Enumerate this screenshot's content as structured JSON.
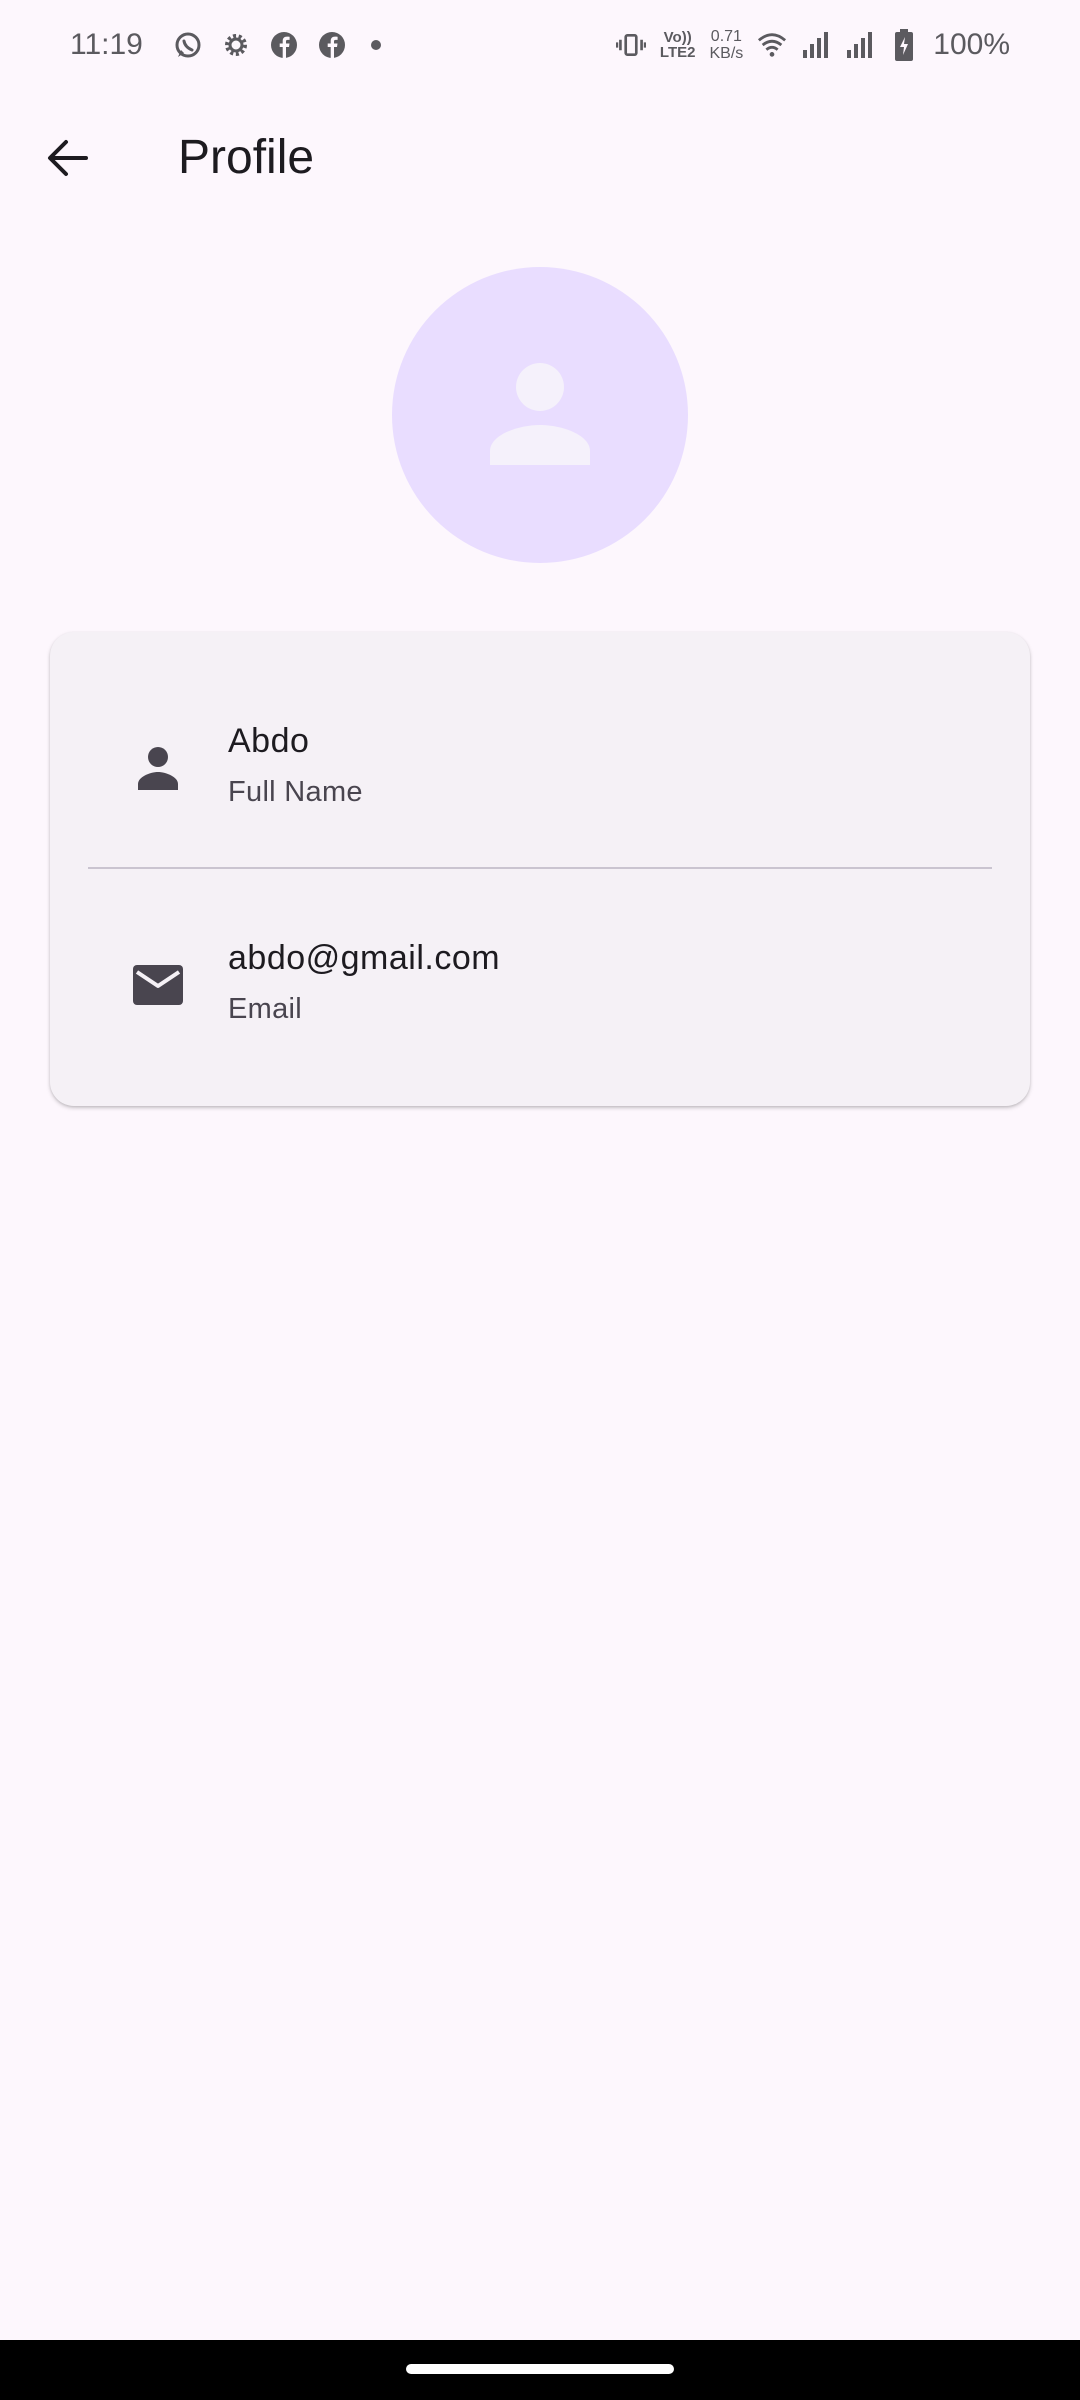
{
  "status_bar": {
    "time": "11:19",
    "network_speed_value": "0.71",
    "network_speed_unit": "KB/s",
    "volte_top": "Vo))",
    "volte_bottom": "LTE2",
    "battery": "100%",
    "icons": [
      "whatsapp-icon",
      "settings-gear-icon",
      "facebook-icon",
      "facebook-icon",
      "notification-dot",
      "vibrate-icon",
      "volte-icon",
      "wifi-icon",
      "signal-icon",
      "signal-icon",
      "battery-charging-icon"
    ]
  },
  "app_bar": {
    "title": "Profile",
    "back_icon": "arrow-back-icon"
  },
  "avatar": {
    "icon": "person-icon",
    "colors": {
      "background": "#e9ddff",
      "foreground": "#f5f1fb"
    }
  },
  "profile": {
    "name_row": {
      "value": "Abdo",
      "label": "Full Name",
      "icon": "person-icon"
    },
    "email_row": {
      "value": "abdo@gmail.com",
      "label": "Email",
      "icon": "mail-icon"
    }
  },
  "colors": {
    "background": "#fdf7fd",
    "card": "#f5f1f6",
    "text_primary": "#1d1b20",
    "text_secondary": "#49454f",
    "icon": "#49454f"
  }
}
